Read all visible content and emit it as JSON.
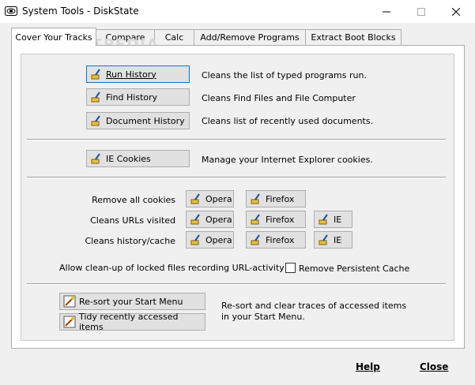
{
  "window": {
    "title": "System Tools - DiskState"
  },
  "tabs": [
    {
      "label": "Cover Your Tracks"
    },
    {
      "label": "Compare"
    },
    {
      "label": "Calc"
    },
    {
      "label": "Add/Remove Programs"
    },
    {
      "label": "Extract Boot Blocks"
    }
  ],
  "history": {
    "run_label": "Run History",
    "run_desc": "Cleans the list of typed programs run.",
    "find_label": "Find History",
    "find_desc": "Cleans Find Files and File Computer",
    "doc_label": "Document History",
    "doc_desc": "Cleans list of recently used documents."
  },
  "ie": {
    "cookies_label": "IE Cookies",
    "cookies_desc": "Manage your Internet Explorer cookies."
  },
  "browsers": {
    "remove_cookies_label": "Remove all cookies",
    "clean_urls_label": "Cleans URLs visited",
    "clean_cache_label": "Cleans history/cache",
    "opera": "Opera",
    "firefox": "Firefox",
    "ie": "IE",
    "locked_label": "Allow clean-up of locked files recording URL-activity",
    "persistent_label": "Remove Persistent Cache",
    "persistent_checked": false
  },
  "startmenu": {
    "resort_label": "Re-sort your Start Menu",
    "tidy_label": "Tidy recently accessed items",
    "desc_line1": "Re-sort and clear traces of accessed items",
    "desc_line2": "in your Start Menu."
  },
  "footer": {
    "help": "Help",
    "close": "Close"
  },
  "watermark": "SOFTPEDIA",
  "colors": {
    "focus": "#0078d7",
    "button_bg": "#e1e1e1"
  }
}
